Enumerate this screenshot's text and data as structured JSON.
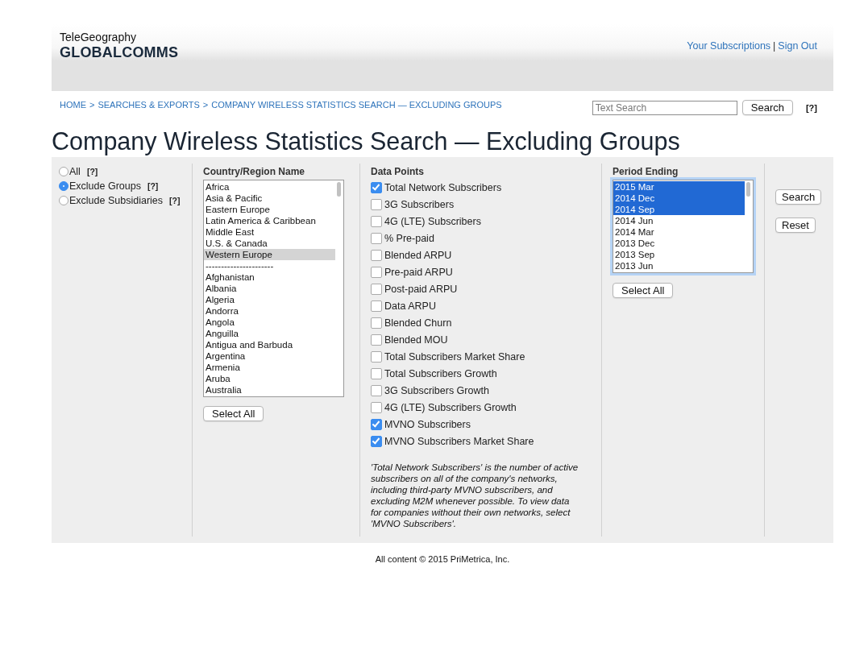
{
  "header": {
    "brand_top": "TeleGeography",
    "brand_main": "GLOBALCOMMS",
    "links": [
      "Your Subscriptions",
      "Sign Out"
    ],
    "link_separator": "|"
  },
  "breadcrumb": {
    "items": [
      "HOME",
      "SEARCHES & EXPORTS",
      "COMPANY WIRELESS STATISTICS SEARCH — EXCLUDING GROUPS"
    ],
    "separator": ">"
  },
  "text_search": {
    "placeholder": "Text Search",
    "button": "Search",
    "help": "[?]"
  },
  "page_title": "Company Wireless Statistics Search — Excluding Groups",
  "scope_options": [
    {
      "label": "All",
      "help": "[?]",
      "selected": false
    },
    {
      "label": "Exclude Groups",
      "help": "[?]",
      "selected": true
    },
    {
      "label": "Exclude Subsidiaries",
      "help": "[?]",
      "selected": false
    }
  ],
  "country_list": {
    "heading": "Country/Region Name",
    "button": "Select All",
    "items": [
      {
        "label": "Africa",
        "selected": false
      },
      {
        "label": "Asia & Pacific",
        "selected": false
      },
      {
        "label": "Eastern Europe",
        "selected": false
      },
      {
        "label": "Latin America & Caribbean",
        "selected": false
      },
      {
        "label": "Middle East",
        "selected": false
      },
      {
        "label": "U.S. & Canada",
        "selected": false
      },
      {
        "label": "Western Europe",
        "selected": true
      },
      {
        "label": "----------------------",
        "selected": false
      },
      {
        "label": "Afghanistan",
        "selected": false
      },
      {
        "label": "Albania",
        "selected": false
      },
      {
        "label": "Algeria",
        "selected": false
      },
      {
        "label": "Andorra",
        "selected": false
      },
      {
        "label": "Angola",
        "selected": false
      },
      {
        "label": "Anguilla",
        "selected": false
      },
      {
        "label": "Antigua and Barbuda",
        "selected": false
      },
      {
        "label": "Argentina",
        "selected": false
      },
      {
        "label": "Armenia",
        "selected": false
      },
      {
        "label": "Aruba",
        "selected": false
      },
      {
        "label": "Australia",
        "selected": false
      }
    ]
  },
  "data_points": {
    "heading": "Data Points",
    "items": [
      {
        "label": "Total Network Subscribers",
        "checked": true
      },
      {
        "label": "3G Subscribers",
        "checked": false
      },
      {
        "label": "4G (LTE) Subscribers",
        "checked": false
      },
      {
        "label": "% Pre-paid",
        "checked": false
      },
      {
        "label": "Blended ARPU",
        "checked": false
      },
      {
        "label": "Pre-paid ARPU",
        "checked": false
      },
      {
        "label": "Post-paid ARPU",
        "checked": false
      },
      {
        "label": "Data ARPU",
        "checked": false
      },
      {
        "label": "Blended Churn",
        "checked": false
      },
      {
        "label": "Blended MOU",
        "checked": false
      },
      {
        "label": "Total Subscribers Market Share",
        "checked": false
      },
      {
        "label": "Total Subscribers Growth",
        "checked": false
      },
      {
        "label": "3G Subscribers Growth",
        "checked": false
      },
      {
        "label": "4G (LTE) Subscribers Growth",
        "checked": false
      },
      {
        "label": "MVNO Subscribers",
        "checked": true
      },
      {
        "label": "MVNO Subscribers Market Share",
        "checked": true
      }
    ],
    "note": "'Total Network Subscribers' is the number of active subscribers on all of the company's networks, including third-party MVNO subscribers, and excluding M2M whenever possible. To view data for companies without their own networks, select 'MVNO Subscribers'."
  },
  "period_list": {
    "heading": "Period Ending",
    "button": "Select All",
    "items": [
      {
        "label": "2015 Mar",
        "selected": true
      },
      {
        "label": "2014 Dec",
        "selected": true
      },
      {
        "label": "2014 Sep",
        "selected": true
      },
      {
        "label": "2014 Jun",
        "selected": false
      },
      {
        "label": "2014 Mar",
        "selected": false
      },
      {
        "label": "2013 Dec",
        "selected": false
      },
      {
        "label": "2013 Sep",
        "selected": false
      },
      {
        "label": "2013 Jun",
        "selected": false
      }
    ]
  },
  "actions": [
    "Search",
    "Reset"
  ],
  "footer": "All content © 2015 PriMetrica, Inc."
}
